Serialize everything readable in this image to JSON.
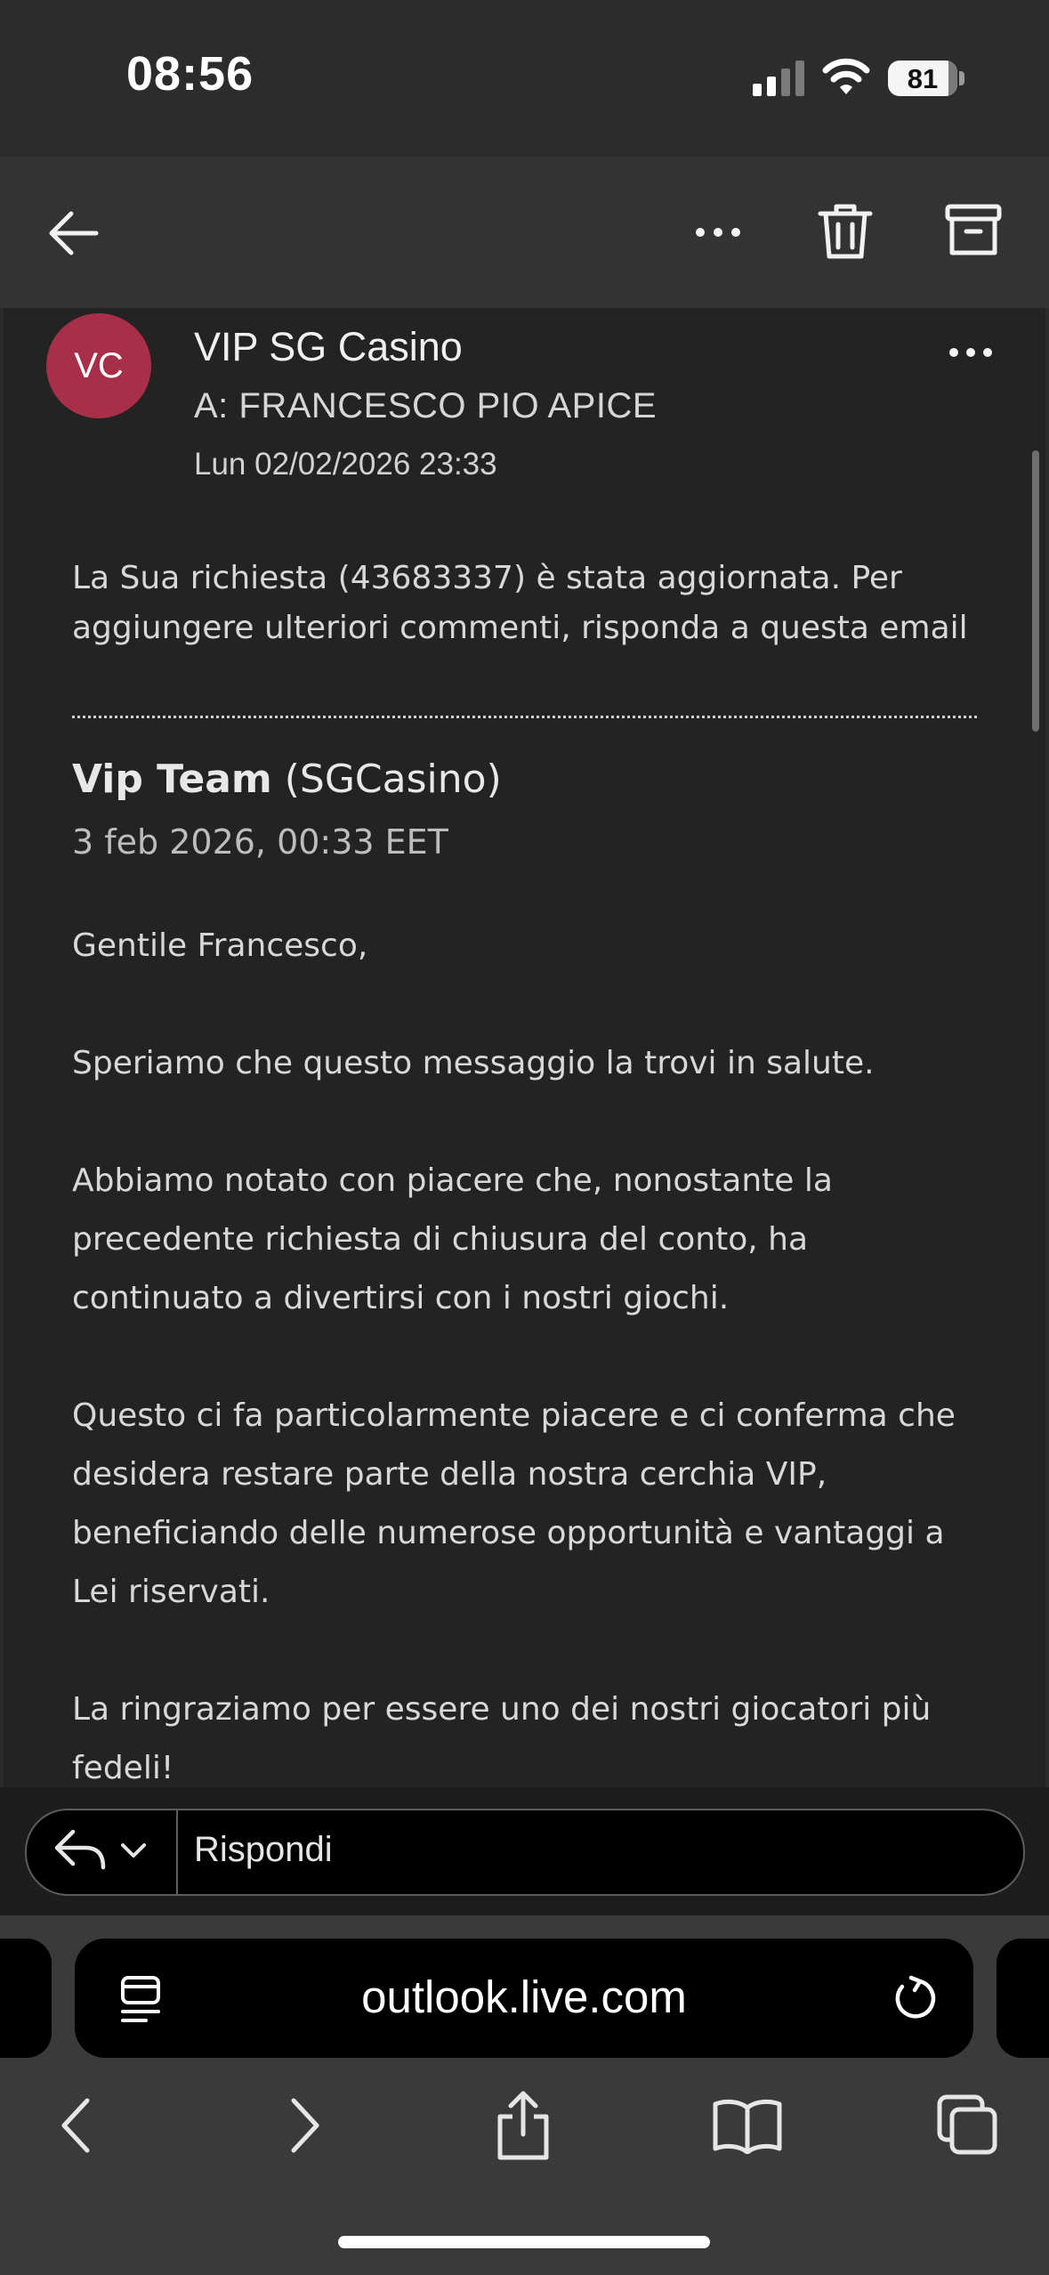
{
  "status_bar": {
    "time": "08:56",
    "battery": "81"
  },
  "toolbar": {
    "back_icon": "arrow-left-icon",
    "more_icon": "more-horizontal-icon",
    "delete_icon": "trash-icon",
    "archive_icon": "archive-icon"
  },
  "email": {
    "avatar_initials": "VC",
    "avatar_color": "#a92f48",
    "sender": "VIP SG Casino",
    "recipient": "A: FRANCESCO PIO APICE",
    "date": "Lun 02/02/2026 23:33",
    "notice": [
      "La Sua richiesta (43683337) è stata aggiornata. Per",
      "aggiungere ulteriori commenti, risponda a questa email"
    ],
    "author_name": "Vip Team",
    "author_org": "(SGCasino)",
    "author_date": "3 feb 2026, 00:33 EET",
    "greeting": "Gentile Francesco,",
    "paragraph1": "Speriamo che questo messaggio la trovi in salute.",
    "paragraph2": [
      "Abbiamo notato con piacere che, nonostante la",
      "precedente richiesta di chiusura del conto, ha",
      "continuato a divertirsi con i nostri giochi."
    ],
    "paragraph3": [
      "Questo ci fa particolarmente piacere e ci conferma che",
      "desidera restare parte della nostra cerchia VIP,",
      "beneficiando delle numerose opportunità e vantaggi a",
      "Lei riservati."
    ],
    "paragraph4": [
      "La ringraziamo per essere uno dei nostri giocatori più",
      "fedeli!"
    ]
  },
  "reply": {
    "label": "Rispondi"
  },
  "browser": {
    "url": "outlook.live.com"
  }
}
